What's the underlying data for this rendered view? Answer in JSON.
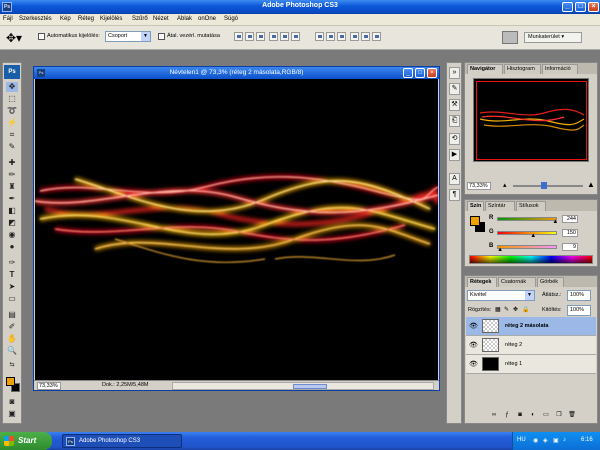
{
  "app": {
    "title": "Adobe Photoshop CS3",
    "icon": "Ps"
  },
  "menu": [
    "Fájl",
    "Szerkesztés",
    "Kép",
    "Réteg",
    "Kijelölés",
    "Szűrő",
    "Nézet",
    "Ablak",
    "onOne",
    "Súgó"
  ],
  "options": {
    "auto_select_label": "Automatikus kijelölés:",
    "auto_select_value": "Csoport",
    "transform_label": "Átal. vezérl. mutatása",
    "workspace_label": "Munkaterület"
  },
  "document": {
    "title": "Névtelen1 @ 73,3% (réteg 2 másolata,RGB/8)",
    "zoom": "73,33%",
    "doc_size": "Dok.: 2,25M/5,48M"
  },
  "navigator": {
    "tabs": [
      "Navigátor",
      "Hisztogram",
      "Információ"
    ],
    "zoom": "73,33%"
  },
  "color_panel": {
    "tabs": [
      "Szín",
      "Színtár",
      "Stílusok"
    ],
    "foreground_color": "#f0a000",
    "background_color": "#000000",
    "channels": [
      {
        "label": "R",
        "value": "244",
        "fraction": 0.957
      },
      {
        "label": "G",
        "value": "150",
        "fraction": 0.588
      },
      {
        "label": "B",
        "value": "9",
        "fraction": 0.035
      }
    ]
  },
  "layers_panel": {
    "tabs": [
      "Rétegek",
      "Csatornák",
      "Görbék"
    ],
    "blend_mode": "Kivétel",
    "opacity_label": "Átlátsz.:",
    "opacity_value": "100%",
    "lock_label": "Rögzítés:",
    "fill_label": "Kitöltés:",
    "fill_value": "100%",
    "layers": [
      {
        "name": "réteg 2 másolata",
        "selected": true
      },
      {
        "name": "réteg 2",
        "selected": false
      },
      {
        "name": "réteg 1",
        "selected": false
      }
    ]
  },
  "taskbar": {
    "start": "Start",
    "task": "Adobe Photoshop CS3",
    "lang": "HU",
    "clock": "6:16"
  }
}
